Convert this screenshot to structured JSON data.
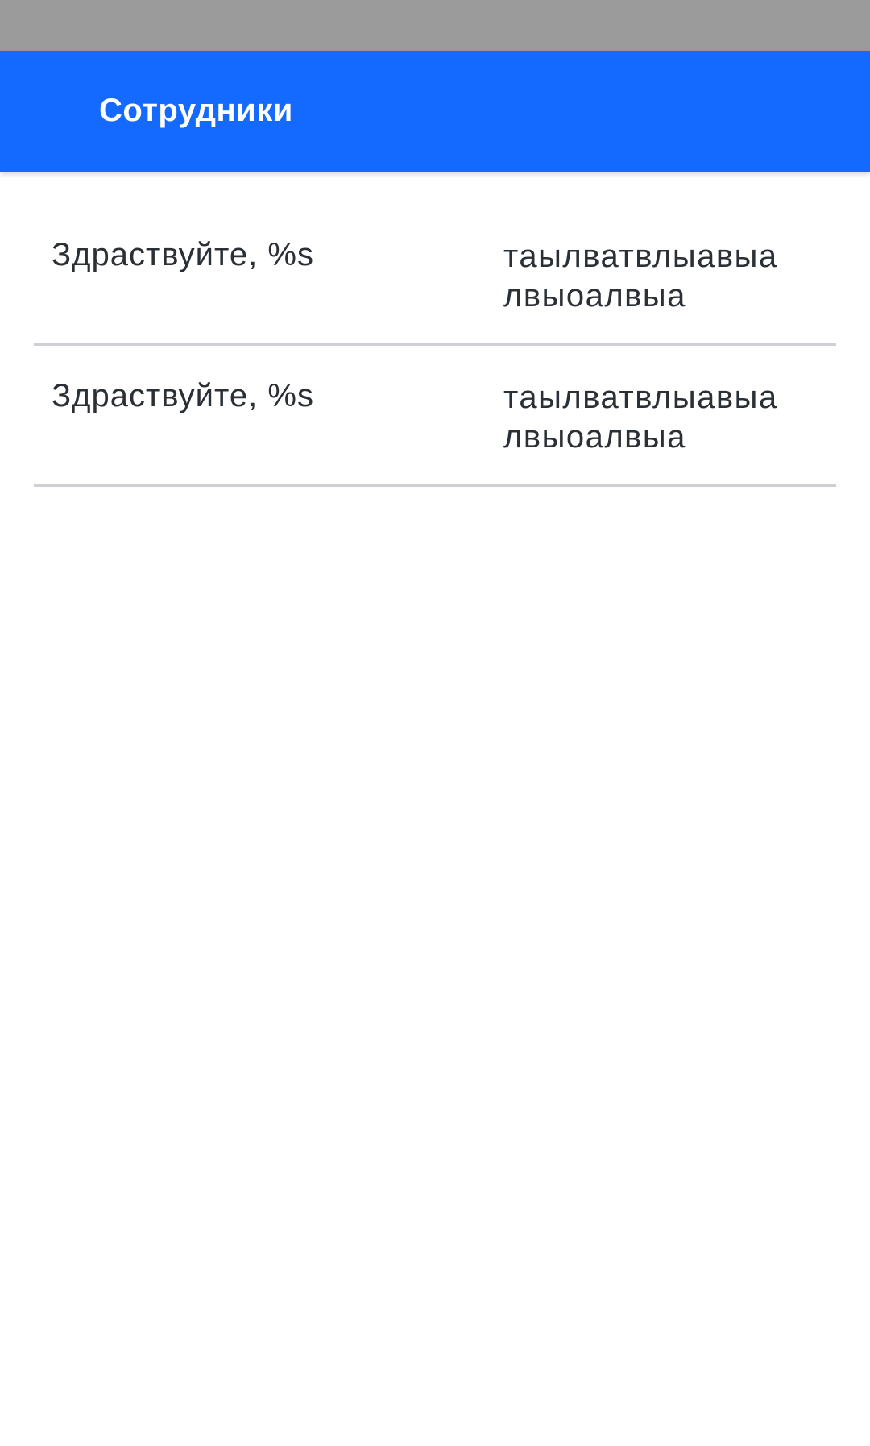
{
  "app_bar": {
    "title": "Сотрудники",
    "background_color": "#1469ff"
  },
  "status_bar": {
    "background_color": "#9b9b9b"
  },
  "employees": [
    {
      "greeting": "Здраствуйте, %s",
      "detail_line1": "таылватвлыавыа",
      "detail_line2": "лвыоалвыа"
    },
    {
      "greeting": "Здраствуйте, %s",
      "detail_line1": "таылватвлыавыа",
      "detail_line2": "лвыоалвыа"
    }
  ]
}
